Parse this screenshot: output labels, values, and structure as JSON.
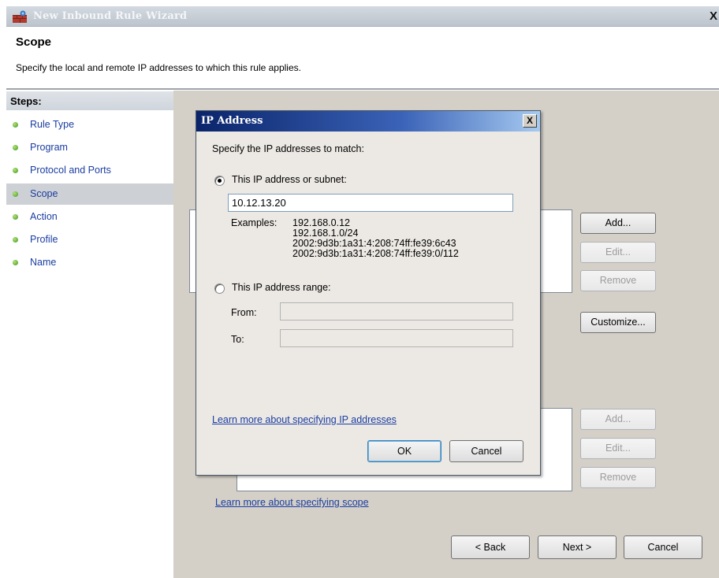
{
  "window": {
    "title": "New Inbound Rule Wizard",
    "close": "X"
  },
  "header": {
    "title": "Scope",
    "subtitle": "Specify the local and remote IP addresses to which this rule applies."
  },
  "steps": {
    "title": "Steps:",
    "items": [
      {
        "label": "Rule Type",
        "active": false
      },
      {
        "label": "Program",
        "active": false
      },
      {
        "label": "Protocol and Ports",
        "active": false
      },
      {
        "label": "Scope",
        "active": true
      },
      {
        "label": "Action",
        "active": false
      },
      {
        "label": "Profile",
        "active": false
      },
      {
        "label": "Name",
        "active": false
      }
    ]
  },
  "main": {
    "local_buttons": {
      "add": "Add...",
      "edit": "Edit...",
      "remove": "Remove"
    },
    "customize": "Customize...",
    "remote_buttons": {
      "add": "Add...",
      "edit": "Edit...",
      "remove": "Remove"
    },
    "scope_link": "Learn more about specifying scope",
    "nav": {
      "back": "< Back",
      "next": "Next >",
      "cancel": "Cancel"
    }
  },
  "dialog": {
    "title": "IP Address",
    "close": "X",
    "prompt": "Specify the IP addresses to match:",
    "option_subnet": {
      "label": "This IP address or subnet:",
      "selected": true,
      "value": "10.12.13.20"
    },
    "examples_label": "Examples:",
    "examples": [
      "192.168.0.12",
      "192.168.1.0/24",
      "2002:9d3b:1a31:4:208:74ff:fe39:6c43",
      "2002:9d3b:1a31:4:208:74ff:fe39:0/112"
    ],
    "option_range": {
      "label": "This IP address range:",
      "selected": false
    },
    "from_label": "From:",
    "from_value": "",
    "to_label": "To:",
    "to_value": "",
    "ip_link": "Learn more about specifying IP addresses",
    "ok": "OK",
    "cancel": "Cancel"
  },
  "colors": {
    "link": "#1a3da1",
    "dialog_title_start": "#0a246a",
    "dialog_title_end": "#a6caf0",
    "panel": "#d4d0c8",
    "step_dot": "#3a9a1c"
  }
}
